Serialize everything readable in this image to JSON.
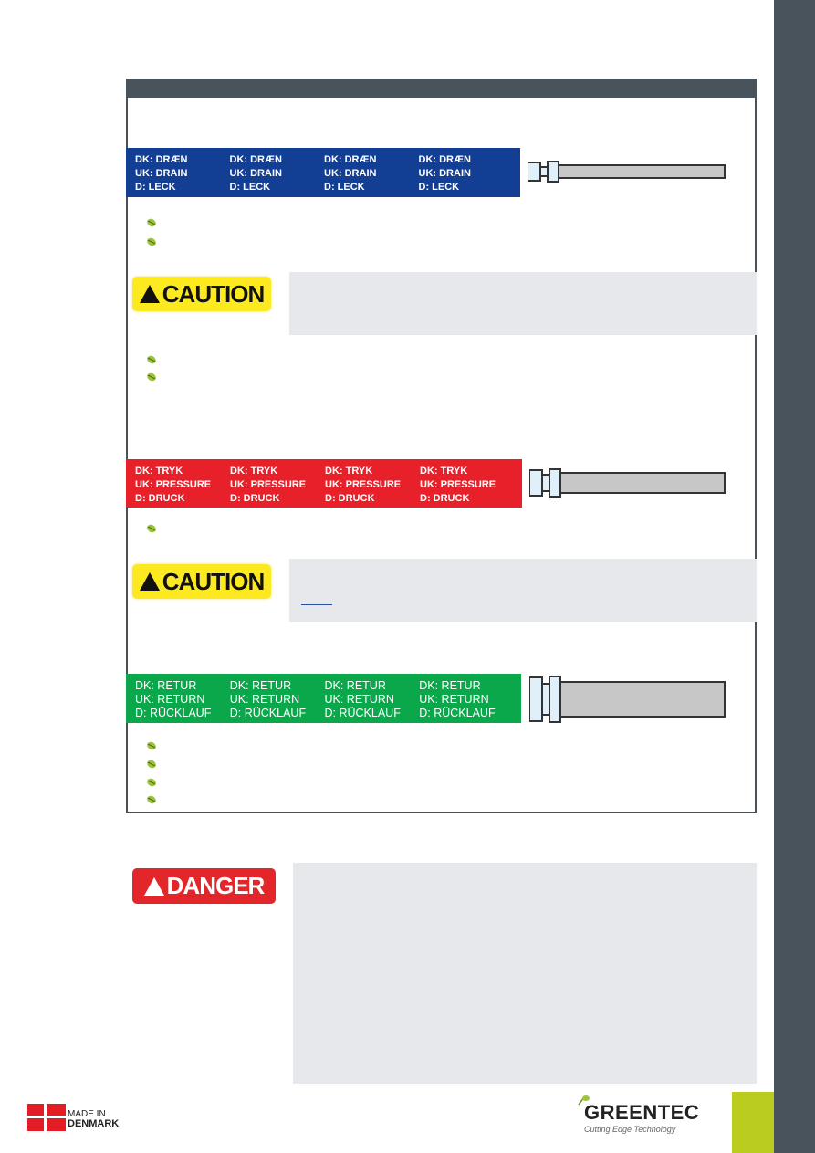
{
  "colors": {
    "drain": "#123f94",
    "pressure": "#e8202a",
    "return": "#0aa84a",
    "sidebar": "#48535b",
    "accent": "#b9cc1f",
    "caution": "#fde91f",
    "danger": "#e3262a"
  },
  "labels": {
    "drain": [
      {
        "dk": "DK: DRÆN",
        "uk": "UK: DRAIN",
        "d": "D: LECK"
      },
      {
        "dk": "DK: DRÆN",
        "uk": "UK: DRAIN",
        "d": "D: LECK"
      },
      {
        "dk": "DK: DRÆN",
        "uk": "UK: DRAIN",
        "d": "D: LECK"
      },
      {
        "dk": "DK: DRÆN",
        "uk": "UK: DRAIN",
        "d": "D: LECK"
      }
    ],
    "pressure": [
      {
        "dk": "DK: TRYK",
        "uk": "UK: PRESSURE",
        "d": "D: DRUCK"
      },
      {
        "dk": "DK: TRYK",
        "uk": "UK: PRESSURE",
        "d": "D: DRUCK"
      },
      {
        "dk": "DK: TRYK",
        "uk": "UK: PRESSURE",
        "d": "D: DRUCK"
      },
      {
        "dk": "DK: TRYK",
        "uk": "UK: PRESSURE",
        "d": "D: DRUCK"
      }
    ],
    "return": [
      {
        "dk": "DK: RETUR",
        "uk": "UK: RETURN",
        "d": "D: RÜCKLAUF"
      },
      {
        "dk": "DK: RETUR",
        "uk": "UK: RETURN",
        "d": "D: RÜCKLAUF"
      },
      {
        "dk": "DK: RETUR",
        "uk": "UK: RETURN",
        "d": "D: RÜCKLAUF"
      },
      {
        "dk": "DK: RETUR",
        "uk": "UK: RETURN",
        "d": "D: RÜCKLAUF"
      }
    ]
  },
  "badges": {
    "caution": "CAUTION",
    "danger": "DANGER"
  },
  "footer": {
    "made_in": "MADE IN",
    "country": "DENMARK",
    "brand": "GREENTEC",
    "tagline": "Cutting Edge Technology"
  }
}
